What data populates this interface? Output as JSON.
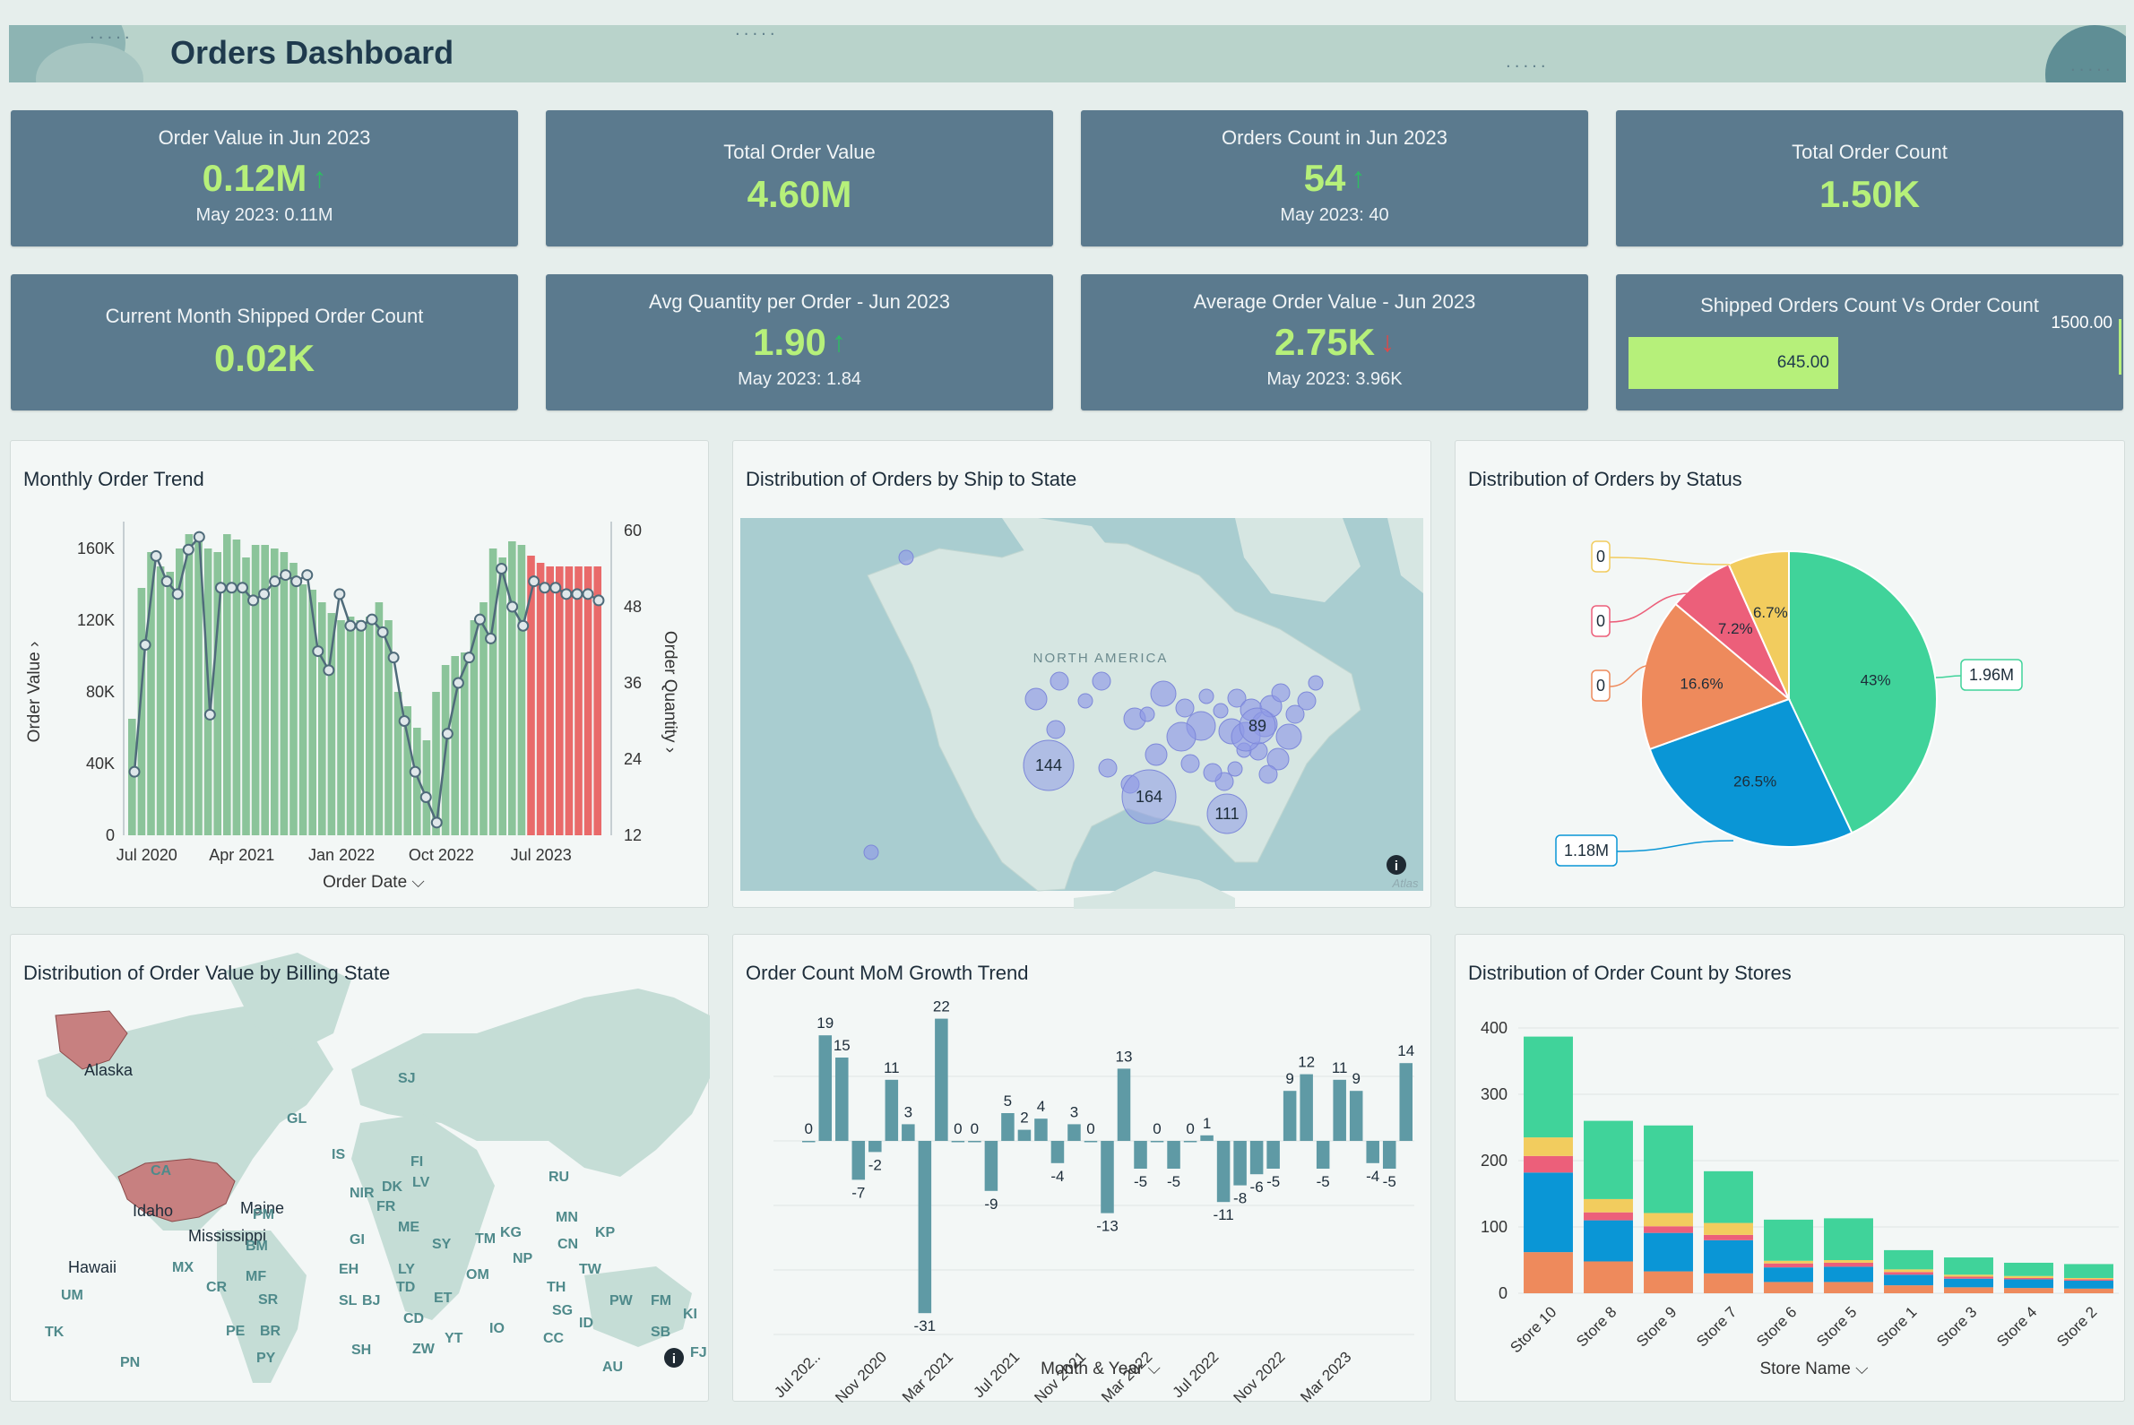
{
  "header": {
    "title": "Orders Dashboard"
  },
  "kpis": [
    {
      "title": "Order Value in Jun 2023",
      "value": "0.12M",
      "trend": "up",
      "sub": "May 2023: 0.11M"
    },
    {
      "title": "Total Order Value",
      "value": "4.60M"
    },
    {
      "title": "Orders Count in Jun 2023",
      "value": "54",
      "trend": "up",
      "sub": "May 2023: 40"
    },
    {
      "title": "Total Order Count",
      "value": "1.50K"
    },
    {
      "title": "Current Month Shipped Order Count",
      "value": "0.02K"
    },
    {
      "title": "Avg Quantity per Order - Jun 2023",
      "value": "1.90",
      "trend": "up",
      "sub": "May 2023: 1.84"
    },
    {
      "title": "Average Order Value - Jun 2023",
      "value": "2.75K",
      "trend": "down",
      "sub": "May 2023: 3.96K"
    },
    {
      "title": "Shipped Orders Count Vs Order Count",
      "shipped": 645,
      "shipped_label": "645.00",
      "target": 1500,
      "target_label": "1500.00"
    }
  ],
  "icons": {
    "up": "↑",
    "down": "↓",
    "info": "i",
    "chevron": "chevron-down-icon"
  },
  "colors": {
    "bar_green": "#8bc49a",
    "bar_red": "#e96a6a",
    "line": "#4f6b7a",
    "bubble": "#8f9ae6",
    "mom_bar": "#5f9aa5"
  },
  "panels": {
    "monthly": {
      "title": "Monthly Order Trend"
    },
    "ship_state": {
      "title": "Distribution of Orders by Ship to State",
      "region_label": "NORTH AMERICA",
      "watermark": "Atlas"
    },
    "status": {
      "title": "Distribution of Orders by Status"
    },
    "billing": {
      "title": "Distribution of Order Value by Billing State"
    },
    "mom": {
      "title": "Order Count MoM Growth Trend"
    },
    "stores": {
      "title": "Distribution of Order Count by Stores"
    }
  },
  "chart_data": [
    {
      "type": "bar",
      "title": "Monthly Order Trend",
      "xlabel": "Order Date",
      "ylabel": "Order Value",
      "y2label": "Order Quantity",
      "ylim": [
        0,
        170000
      ],
      "y2lim": [
        12,
        60
      ],
      "yticks": [
        "0",
        "40K",
        "80K",
        "120K",
        "160K"
      ],
      "y2ticks": [
        "12",
        "24",
        "36",
        "48",
        "60"
      ],
      "xticks": [
        "Jul 2020",
        "Apr 2021",
        "Jan 2022",
        "Oct 2022",
        "Jul 2023"
      ],
      "series": [
        {
          "name": "Order Value",
          "values": [
            65000,
            138000,
            158000,
            150000,
            147000,
            160000,
            168000,
            165000,
            160000,
            158000,
            168000,
            165000,
            155000,
            162000,
            162000,
            160000,
            158000,
            152000,
            140000,
            137000,
            130000,
            124000,
            120000,
            122000,
            120000,
            122000,
            130000,
            120000,
            80000,
            72000,
            60000,
            53000,
            80000,
            95000,
            100000,
            102000,
            120000,
            130000,
            160000,
            155000,
            164000,
            162000,
            156000,
            152000,
            150000,
            150000,
            150000,
            150000,
            150000,
            150000
          ]
        },
        {
          "name": "Order Quantity",
          "values": [
            22,
            42,
            56,
            52,
            50,
            57,
            59,
            31,
            51,
            51,
            51,
            49,
            50,
            52,
            53,
            52,
            53,
            41,
            38,
            50,
            45,
            45,
            46,
            44,
            40,
            30,
            22,
            18,
            14,
            28,
            36,
            40,
            46,
            43,
            54,
            48,
            45,
            52,
            51,
            51,
            50,
            50,
            50,
            49
          ]
        }
      ],
      "projected_from_index": 37
    },
    {
      "type": "scatter",
      "title": "Distribution of Orders by Ship to State",
      "labels": [
        "144",
        "164",
        "111",
        "89"
      ]
    },
    {
      "type": "pie",
      "title": "Distribution of Orders by Status",
      "slices": [
        {
          "label": "43%",
          "value": 43,
          "color": "#40d39a"
        },
        {
          "label": "26.5%",
          "value": 26.5,
          "color": "#0a96d6"
        },
        {
          "label": "16.6%",
          "value": 16.6,
          "color": "#ee8a5c"
        },
        {
          "label": "7.2%",
          "value": 7.2,
          "color": "#ec5f7a"
        },
        {
          "label": "6.7%",
          "value": 6.7,
          "color": "#f2cc5e"
        }
      ],
      "callouts": [
        "1.96M",
        "1.18M",
        "0",
        "0",
        "0"
      ]
    },
    {
      "type": "heatmap",
      "title": "Distribution of Order Value by Billing State",
      "labels": [
        "Alaska",
        "Hawaii",
        "Idaho",
        "Maine",
        "Mississippi",
        "CA",
        "GL",
        "IS",
        "SJ",
        "UM",
        "TK",
        "PN",
        "MX",
        "PM",
        "BM",
        "CR",
        "MF",
        "SR",
        "PE",
        "BR",
        "PY",
        "FI",
        "NIR",
        "DK",
        "LV",
        "FR",
        "ME",
        "GI",
        "SY",
        "TM",
        "KG",
        "CN",
        "KP",
        "MN",
        "RU",
        "EH",
        "LY",
        "TD",
        "ET",
        "SL",
        "BJ",
        "CD",
        "ZW",
        "YT",
        "SH",
        "OM",
        "NP",
        "TH",
        "TW",
        "PW",
        "FM",
        "SG",
        "ID",
        "IO",
        "CC",
        "SB",
        "KI",
        "AU",
        "FJ"
      ]
    },
    {
      "type": "bar",
      "title": "Order Count MoM Growth Trend",
      "xlabel": "Month & Year",
      "xticks": [
        "Jul 202..",
        "Nov 2020",
        "Mar 2021",
        "Jul 2021",
        "Nov 2021",
        "Mar 2022",
        "Jul 2022",
        "Nov 2022",
        "Mar 2023"
      ],
      "values": [
        0,
        19,
        15,
        -7,
        -2,
        11,
        3,
        -31,
        22,
        0,
        0,
        -9,
        5,
        2,
        4,
        -4,
        3,
        0,
        -13,
        13,
        -5,
        0,
        -5,
        0,
        1,
        -11,
        -8,
        -6,
        -5,
        9,
        12,
        -5,
        11,
        9,
        -4,
        -5,
        14
      ],
      "ylim": [
        -31,
        22
      ]
    },
    {
      "type": "bar",
      "title": "Distribution of Order Count by Stores",
      "xlabel": "Store Name",
      "categories": [
        "Store 10",
        "Store 8",
        "Store 9",
        "Store 7",
        "Store 6",
        "Store 5",
        "Store 1",
        "Store 3",
        "Store 4",
        "Store 2"
      ],
      "ylim": [
        0,
        400
      ],
      "yticks": [
        "0",
        "100",
        "200",
        "300",
        "400"
      ],
      "series": [
        {
          "color": "#ee8a5c",
          "values": [
            62,
            48,
            33,
            30,
            17,
            17,
            12,
            9,
            8,
            7
          ]
        },
        {
          "color": "#0a96d6",
          "values": [
            120,
            62,
            58,
            50,
            22,
            23,
            16,
            13,
            13,
            12
          ]
        },
        {
          "color": "#ec5f7a",
          "values": [
            25,
            12,
            10,
            8,
            6,
            6,
            4,
            3,
            2,
            2
          ]
        },
        {
          "color": "#f2cc5e",
          "values": [
            28,
            20,
            20,
            18,
            4,
            4,
            4,
            3,
            3,
            2
          ]
        },
        {
          "color": "#40d39a",
          "values": [
            152,
            118,
            132,
            78,
            62,
            63,
            29,
            26,
            20,
            21
          ]
        }
      ]
    }
  ]
}
